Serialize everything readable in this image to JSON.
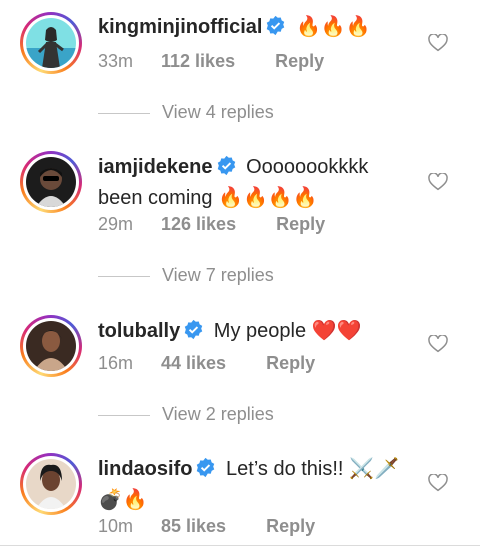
{
  "comments": [
    {
      "username": "kingminjinofficial",
      "text": " 🔥🔥🔥",
      "time": "33m",
      "likes": "112 likes",
      "reply": "Reply",
      "view_replies": "View 4 replies"
    },
    {
      "username": "iamjidekene",
      "text": " Oooooookkkk been coming 🔥🔥🔥🔥",
      "time": "29m",
      "likes": "126 likes",
      "reply": "Reply",
      "view_replies": "View 7 replies"
    },
    {
      "username": "tolubally",
      "text": " My people ❤️❤️",
      "time": "16m",
      "likes": "44 likes",
      "reply": "Reply",
      "view_replies": "View 2 replies"
    },
    {
      "username": "lindaosifo",
      "text": " Let’s do this!! ⚔️🗡️ 💣🔥",
      "time": "10m",
      "likes": "85 likes",
      "reply": "Reply"
    }
  ],
  "colors": {
    "verified_badge": "#3897f0",
    "secondary_text": "#8e8e8e",
    "primary_text": "#262626"
  },
  "icons": {
    "verified": "verified-badge-icon",
    "like": "heart-outline-icon"
  }
}
